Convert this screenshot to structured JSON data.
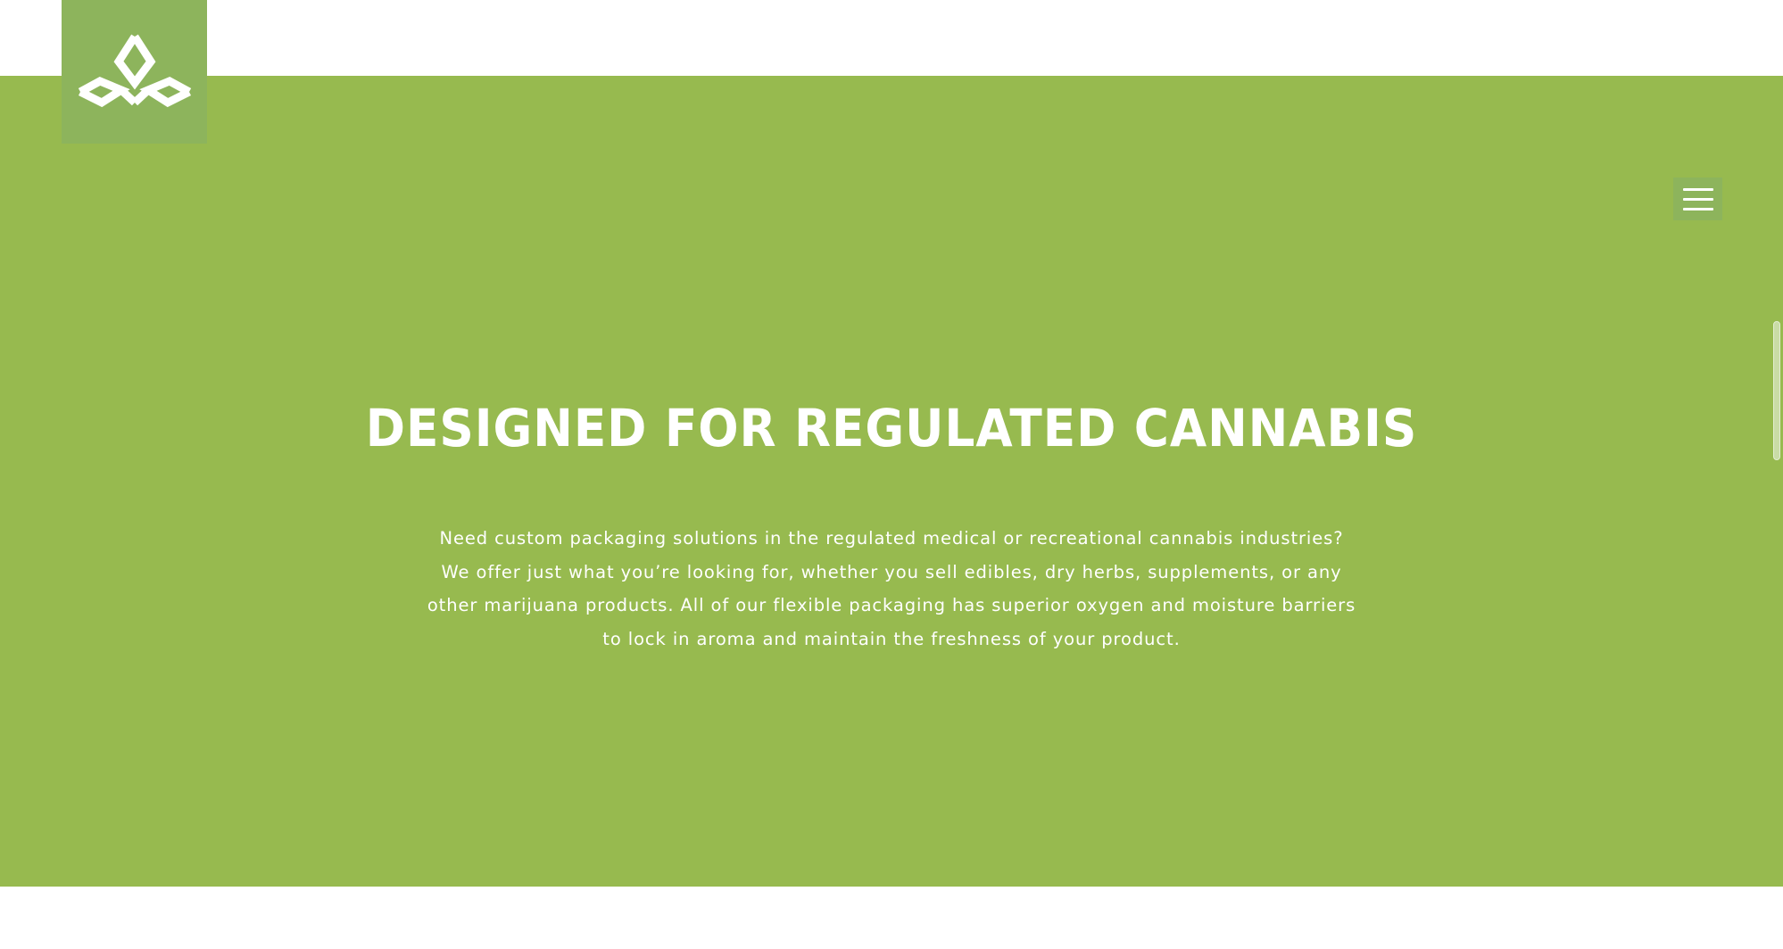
{
  "header": {
    "logo_icon": "leaf-logo-icon",
    "menu_icon": "hamburger-menu-icon"
  },
  "hero": {
    "title": "DESIGNED FOR REGULATED CANNABIS",
    "paragraph_lines": [
      "Need custom packaging solutions in the regulated medical or recreational cannabis industries?",
      "We offer just what you’re looking for, whether you sell edibles, dry herbs, supplements, or any",
      "other marijuana products. All of our flexible packaging has superior oxygen and moisture barriers",
      "to lock in aroma and maintain the freshness of your product."
    ]
  },
  "colors": {
    "hero_background": "#97ba4f",
    "logo_background": "#8db45c",
    "text": "#ffffff",
    "page_background": "#ffffff"
  }
}
